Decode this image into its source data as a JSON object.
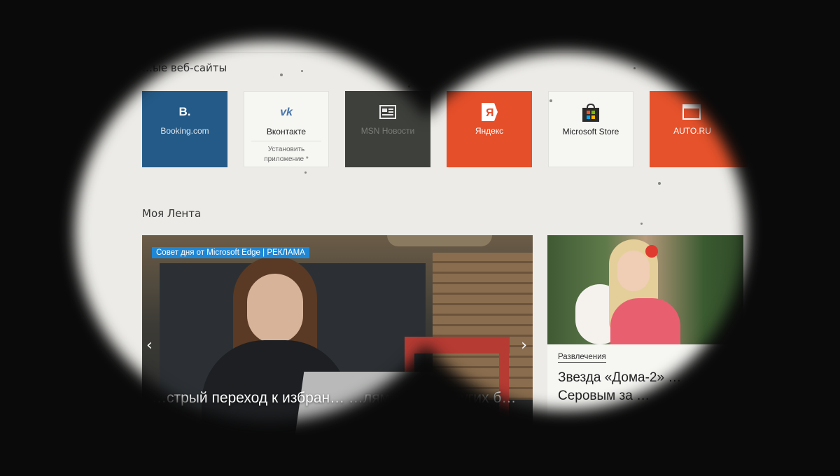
{
  "top_sites": {
    "title": "…ые веб-сайты",
    "tiles": [
      {
        "label": "Booking.com",
        "icon": "booking-b-icon",
        "glyph": "B.",
        "bg": "#245a87"
      },
      {
        "label": "Вконтакте",
        "icon": "vk-icon",
        "glyph": "vk",
        "sub": "Установить приложение",
        "sub_glyph": "*",
        "bg": "#f6f6f3"
      },
      {
        "label": "MSN Новости",
        "icon": "news-icon",
        "bg": "#3e403c"
      },
      {
        "label": "Яндекс",
        "icon": "yandex-icon",
        "glyph": "Я",
        "bg": "#e54f2a"
      },
      {
        "label": "Microsoft Store",
        "icon": "store-bag-icon",
        "bg": "#f6f6f3"
      },
      {
        "label": "AUTO.RU",
        "icon": "auto-ru-icon",
        "bg": "#e5522b"
      }
    ]
  },
  "feed": {
    "title": "Моя Лента",
    "hero": {
      "badge": "Совет дня от Microsoft Edge | РЕКЛАМА",
      "title": "…стрый переход к избран… …лям и … из других б…",
      "prev_glyph": "‹",
      "next_glyph": "›"
    },
    "card": {
      "category": "Развлечения",
      "title": "Звезда «Дома-2» … Серовым за …"
    }
  }
}
